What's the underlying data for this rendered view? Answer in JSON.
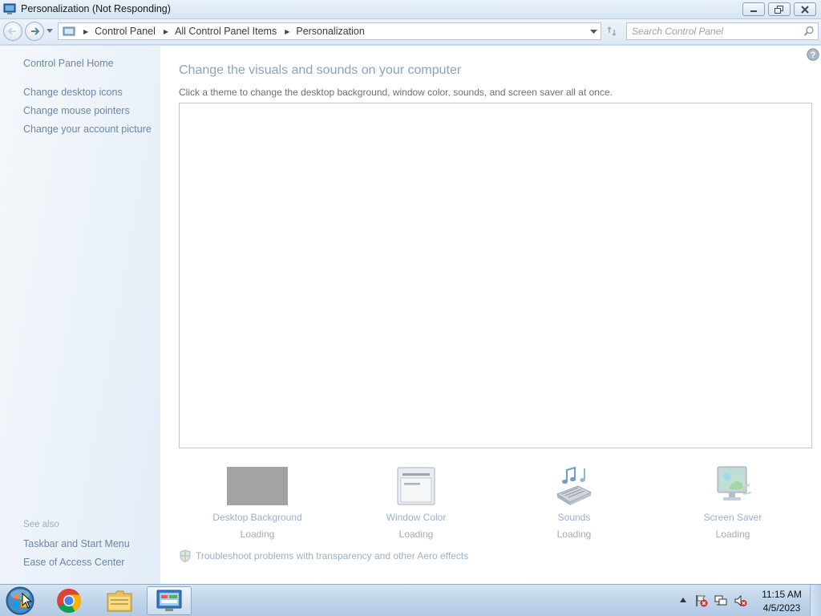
{
  "window": {
    "title": "Personalization (Not Responding)"
  },
  "navigation": {
    "breadcrumbs": [
      "Control Panel",
      "All Control Panel Items",
      "Personalization"
    ],
    "search_placeholder": "Search Control Panel"
  },
  "sidebar": {
    "home_link": "Control Panel Home",
    "links": [
      "Change desktop icons",
      "Change mouse pointers",
      "Change your account picture"
    ],
    "see_also_heading": "See also",
    "see_also_links": [
      "Taskbar and Start Menu",
      "Ease of Access Center"
    ]
  },
  "main": {
    "heading": "Change the visuals and sounds on your computer",
    "description": "Click a theme to change the desktop background, window color, sounds, and screen saver all at once.",
    "tiles": [
      {
        "label": "Desktop Background",
        "status": "Loading",
        "icon": "desktop-background-icon"
      },
      {
        "label": "Window Color",
        "status": "Loading",
        "icon": "window-color-icon"
      },
      {
        "label": "Sounds",
        "status": "Loading",
        "icon": "sounds-icon"
      },
      {
        "label": "Screen Saver",
        "status": "Loading",
        "icon": "screen-saver-icon"
      }
    ],
    "troubleshoot_link": "Troubleshoot problems with transparency and other Aero effects"
  },
  "taskbar": {
    "pinned": [
      "start-orb",
      "chrome-icon",
      "file-explorer-icon",
      "control-panel-icon"
    ],
    "active_item": "control-panel-icon",
    "tray_icons": [
      "show-hidden-icons-arrow",
      "action-center-flag-icon",
      "network-icon",
      "volume-muted-icon"
    ],
    "time": "11:15 AM",
    "date": "4/5/2023"
  },
  "colors": {
    "link": "#6a87a6",
    "heading": "#8aa3bd",
    "taskbar": "#bfd5ea"
  }
}
